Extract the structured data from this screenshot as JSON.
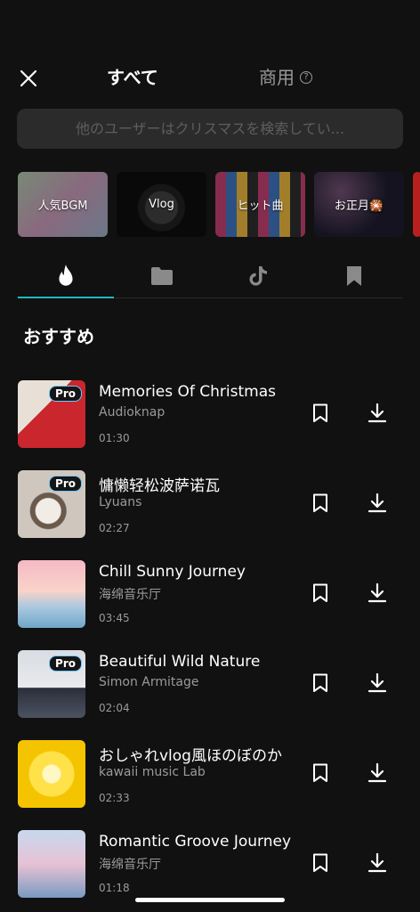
{
  "header": {
    "tab_all": "すべて",
    "tab_commercial": "商用",
    "help_symbol": "?"
  },
  "search": {
    "placeholder": "他のユーザーはクリスマスを検索してい..."
  },
  "categories": [
    {
      "label": "人気BGM"
    },
    {
      "label": "Vlog"
    },
    {
      "label": "ヒット曲"
    },
    {
      "label": "お正月🎇"
    },
    {
      "label": ""
    }
  ],
  "icon_tabs": [
    "flame-icon",
    "folder-icon",
    "tiktok-icon",
    "bookmark-icon"
  ],
  "section": {
    "title": "おすすめ"
  },
  "tracks": [
    {
      "title": "Memories Of Christmas",
      "artist": "Audioknap",
      "duration": "01:30",
      "badge": "Pro"
    },
    {
      "title": "慵懒轻松波萨诺瓦",
      "artist": "Lyuans",
      "duration": "02:27",
      "badge": "Pro"
    },
    {
      "title": "Chill Sunny Journey",
      "artist": "海绵音乐厅",
      "duration": "03:45",
      "badge": ""
    },
    {
      "title": "Beautiful Wild Nature",
      "artist": "Simon Armitage",
      "duration": "02:04",
      "badge": "Pro"
    },
    {
      "title": "おしゃれvlog風ほのぼのか",
      "artist": "kawaii music Lab",
      "duration": "02:33",
      "badge": ""
    },
    {
      "title": "Romantic Groove Journey",
      "artist": "海绵音乐厅",
      "duration": "01:18",
      "badge": ""
    }
  ],
  "colors": {
    "background": "#111111",
    "accent": "#1fb7c0",
    "muted_text": "#9a9a9a"
  }
}
